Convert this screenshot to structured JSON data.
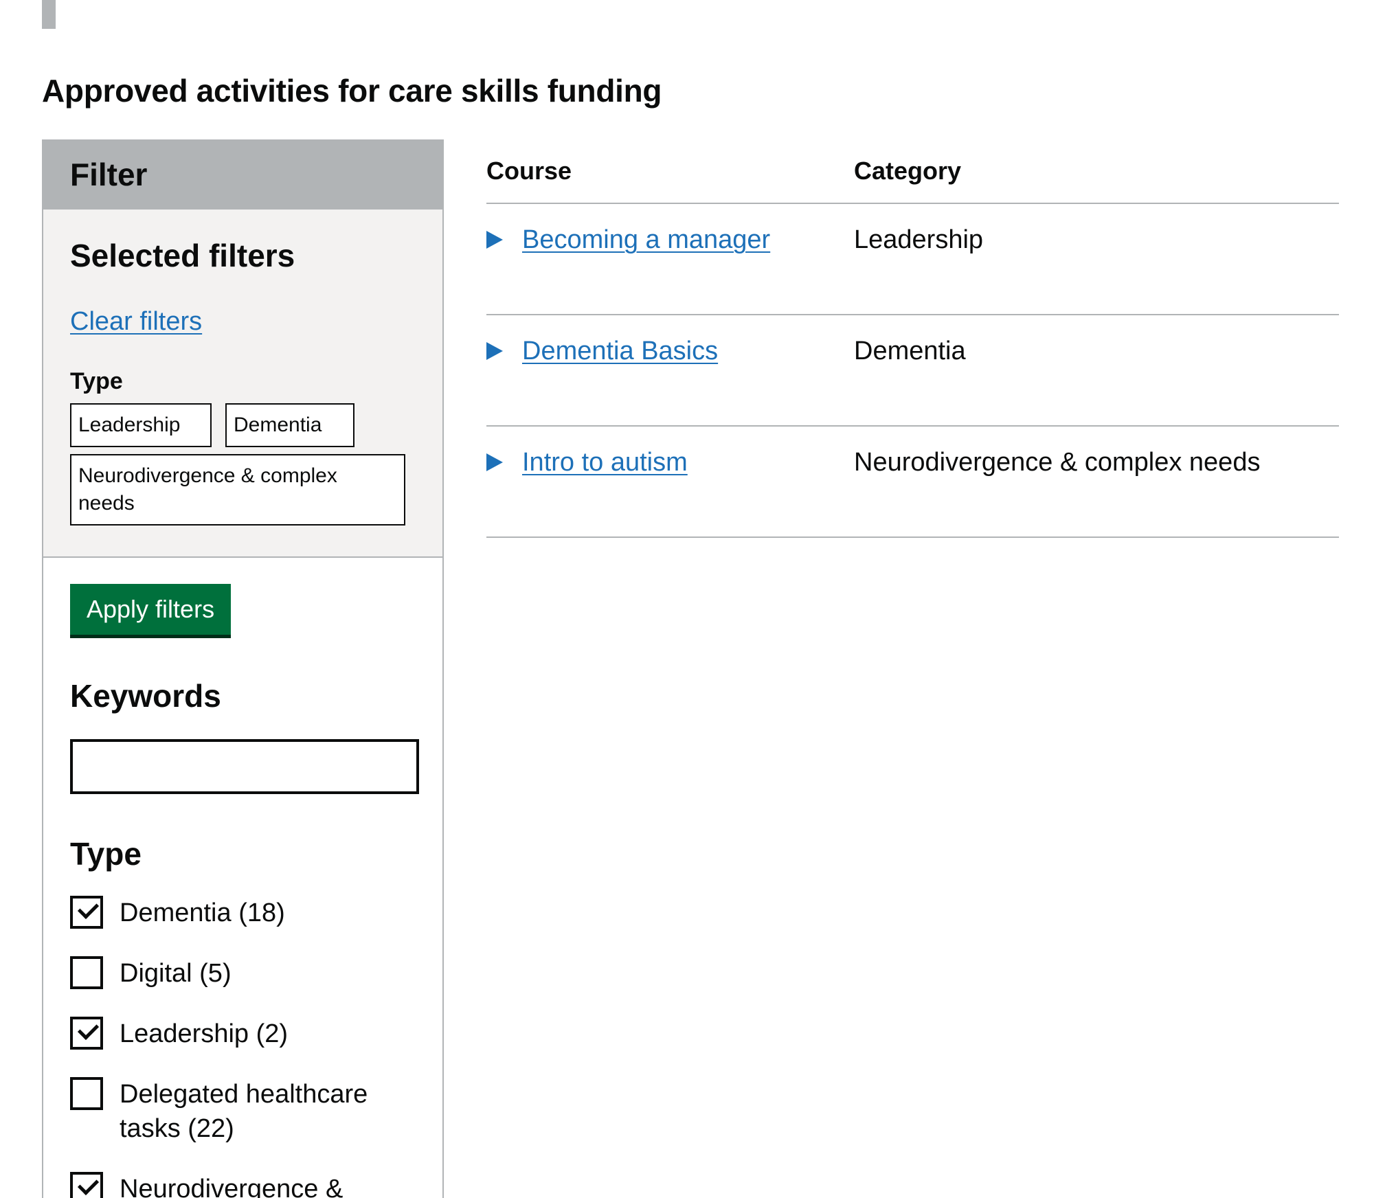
{
  "page_title": "Approved activities for care skills funding",
  "filter": {
    "heading": "Filter",
    "selected": {
      "heading": "Selected filters",
      "clear_label": "Clear filters",
      "type_label": "Type",
      "tags": [
        "Leadership",
        "Dementia",
        "Neurodivergence & complex needs"
      ]
    },
    "apply_label": "Apply filters",
    "keywords": {
      "heading": "Keywords",
      "value": "",
      "placeholder": ""
    },
    "type": {
      "heading": "Type",
      "options": [
        {
          "label": "Dementia (18)",
          "checked": true
        },
        {
          "label": "Digital (5)",
          "checked": false
        },
        {
          "label": "Leadership (2)",
          "checked": true
        },
        {
          "label": "Delegated healthcare tasks (22)",
          "checked": false
        },
        {
          "label": "Neurodivergence &",
          "checked": true
        }
      ]
    }
  },
  "table": {
    "headers": {
      "course": "Course",
      "category": "Category"
    },
    "rows": [
      {
        "course": "Becoming a manager",
        "category": "Leadership"
      },
      {
        "course": "Dementia Basics",
        "category": "Dementia"
      },
      {
        "course": "Intro to autism",
        "category": "Neurodivergence & complex needs"
      }
    ]
  },
  "colors": {
    "link": "#1d70b8",
    "button": "#00703c",
    "panel_header": "#b1b4b6",
    "panel_bg": "#f3f2f1",
    "text": "#0b0c0c"
  }
}
